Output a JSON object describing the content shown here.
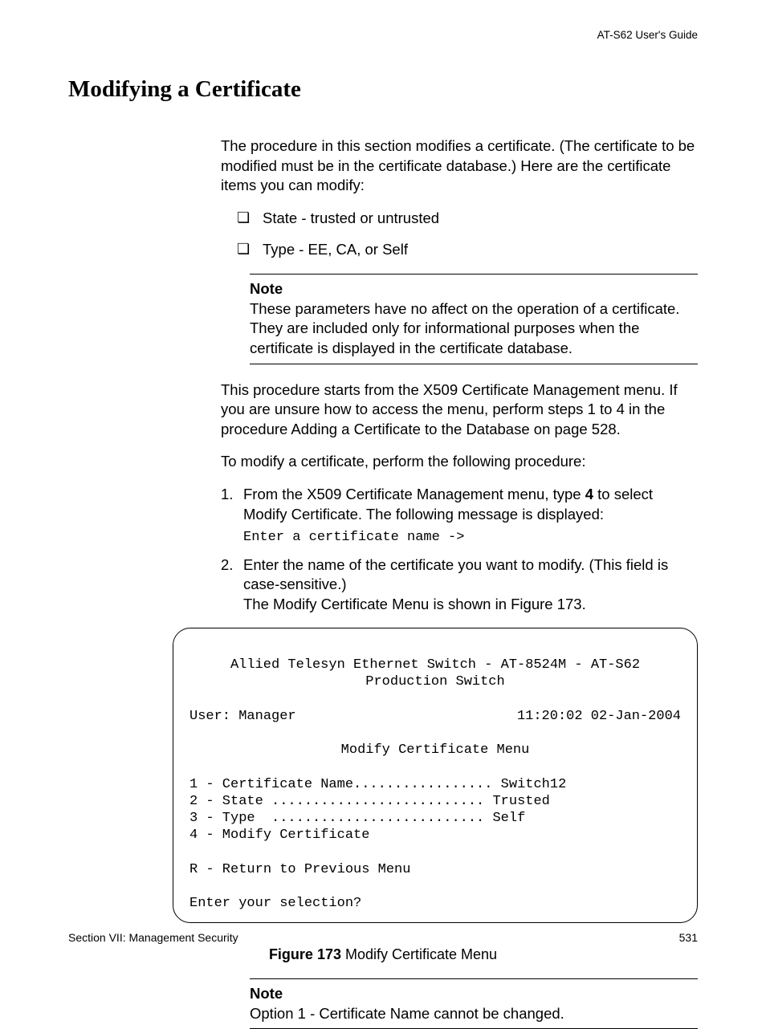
{
  "header": {
    "guide": "AT-S62 User's Guide"
  },
  "title": "Modifying a Certificate",
  "intro": "The procedure in this section modifies a certificate. (The certificate to be modified must be in the certificate database.) Here are the certificate items you can modify:",
  "checklist": [
    "State - trusted or untrusted",
    "Type - EE, CA, or Self"
  ],
  "note1": {
    "label": "Note",
    "text": "These parameters have no affect on the operation of a certificate. They are included only for informational purposes when the certificate is displayed in the certificate database."
  },
  "para2": "This procedure starts from the X509 Certificate Management menu. If you are unsure how to access the menu, perform steps 1 to 4 in the procedure Adding a Certificate to the Database on page 528.",
  "para3": "To modify a certificate, perform the following procedure:",
  "steps": [
    {
      "num": "1.",
      "pre": "From the X509 Certificate Management menu, type ",
      "bold": "4",
      "post": " to select Modify Certificate. The following message is displayed:",
      "mono": "Enter a certificate name ->"
    },
    {
      "num": "2.",
      "pre": "Enter the name of the certificate you want to modify. (This field is case-sensitive.)",
      "follow": "The Modify Certificate Menu is shown in Figure 173."
    }
  ],
  "terminal": {
    "line1": "Allied Telesyn Ethernet Switch - AT-8524M - AT-S62",
    "line2": "Production Switch",
    "userLabel": "User: Manager",
    "timestamp": "11:20:02 02-Jan-2004",
    "menuTitle": "Modify Certificate Menu",
    "opt1": "1 - Certificate Name................. Switch12",
    "opt2": "2 - State .......................... Trusted",
    "opt3": "3 - Type  .......................... Self",
    "opt4": "4 - Modify Certificate",
    "optR": "R - Return to Previous Menu",
    "prompt": "Enter your selection?"
  },
  "figure": {
    "label": "Figure 173",
    "caption": "  Modify Certificate Menu"
  },
  "note2": {
    "label": "Note",
    "text": "Option 1 - Certificate Name cannot be changed."
  },
  "footer": {
    "left": "Section VII: Management Security",
    "right": "531"
  }
}
